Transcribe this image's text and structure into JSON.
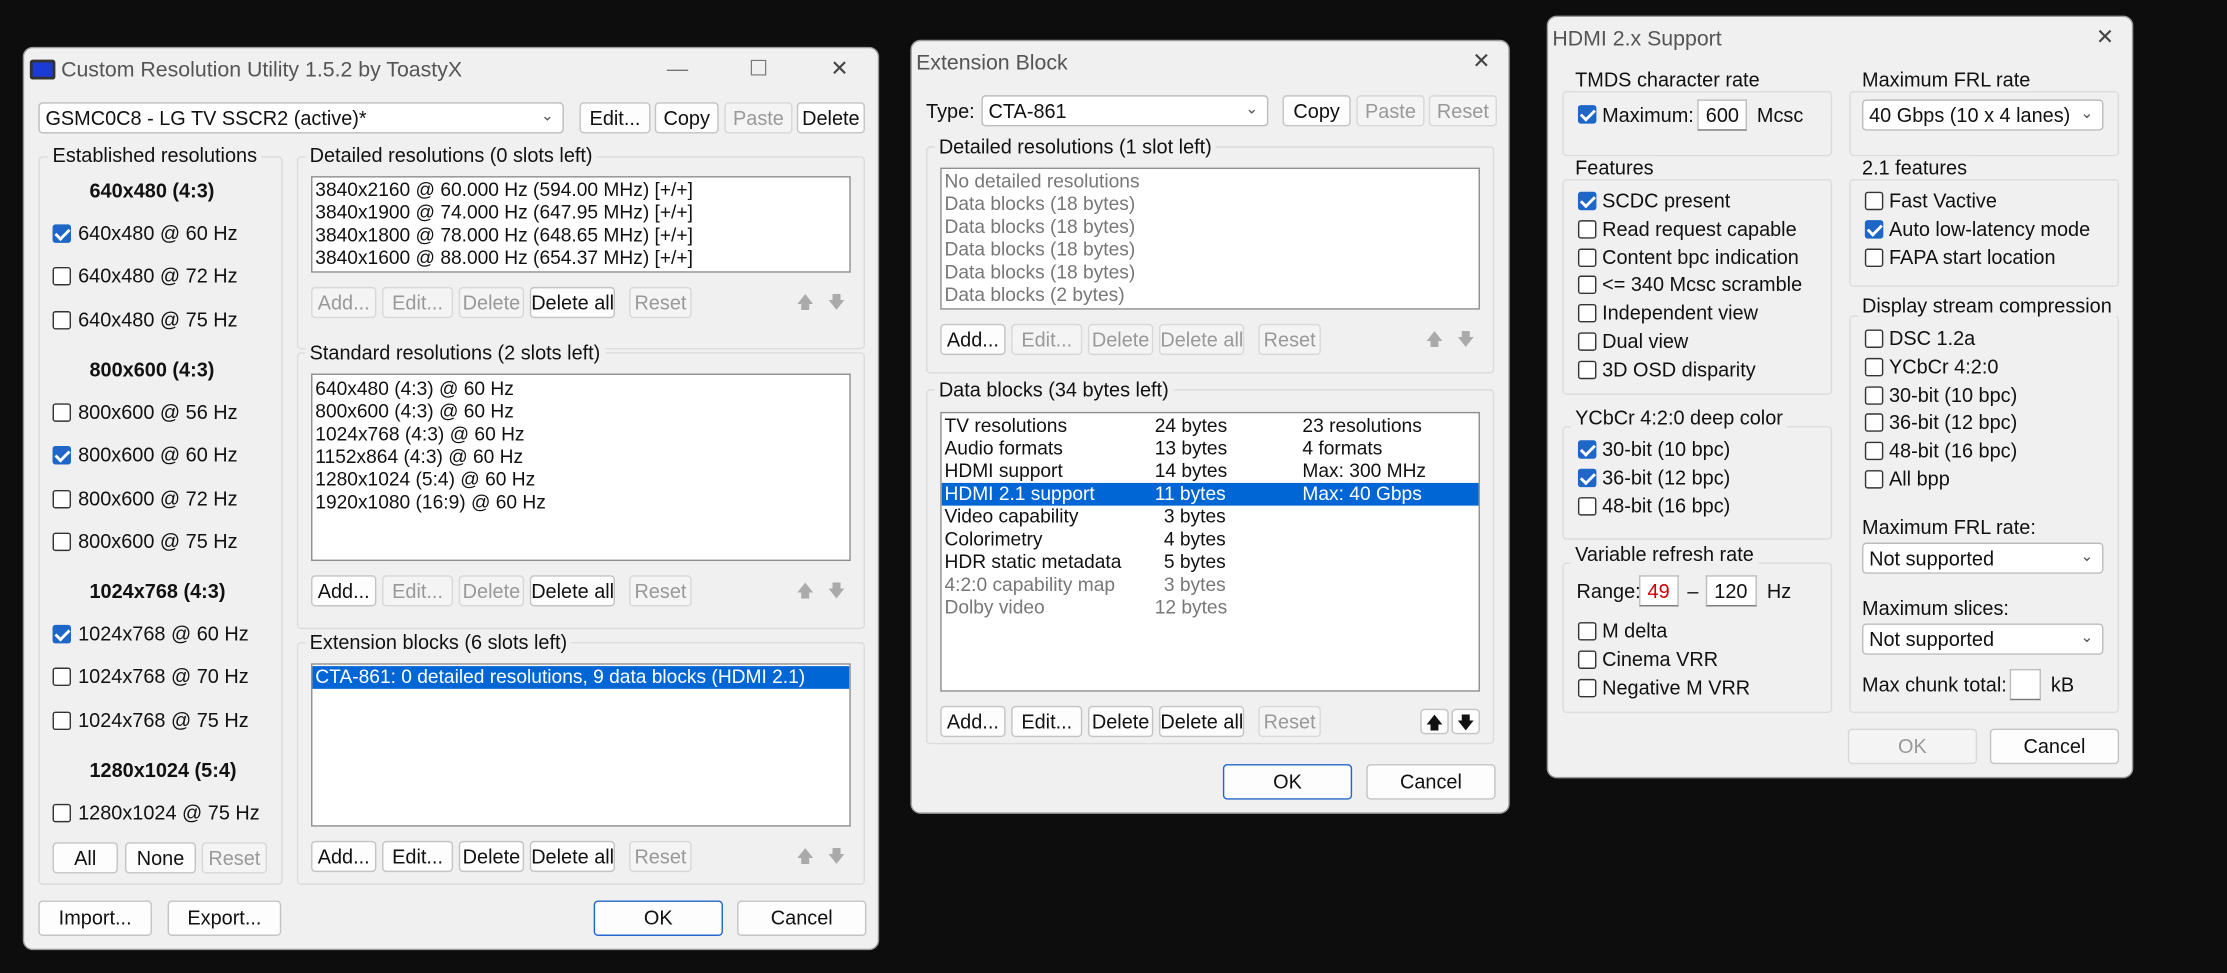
{
  "cru": {
    "title": "Custom Resolution Utility 1.5.2 by ToastyX",
    "display": "GSMC0C8 - LG TV SSCR2 (active)*",
    "top_buttons": [
      "Edit...",
      "Copy",
      "Paste",
      "Delete"
    ],
    "established": {
      "label": "Established resolutions",
      "groups": [
        {
          "heading": "640x480 (4:3)",
          "items": [
            {
              "label": "640x480 @ 60 Hz",
              "checked": true
            },
            {
              "label": "640x480 @ 72 Hz",
              "checked": false
            },
            {
              "label": "640x480 @ 75 Hz",
              "checked": false
            }
          ]
        },
        {
          "heading": "800x600 (4:3)",
          "items": [
            {
              "label": "800x600 @ 56 Hz",
              "checked": false
            },
            {
              "label": "800x600 @ 60 Hz",
              "checked": true
            },
            {
              "label": "800x600 @ 72 Hz",
              "checked": false
            },
            {
              "label": "800x600 @ 75 Hz",
              "checked": false
            }
          ]
        },
        {
          "heading": "1024x768 (4:3)",
          "items": [
            {
              "label": "1024x768 @ 60 Hz",
              "checked": true
            },
            {
              "label": "1024x768 @ 70 Hz",
              "checked": false
            },
            {
              "label": "1024x768 @ 75 Hz",
              "checked": false
            }
          ]
        },
        {
          "heading": "1280x1024 (5:4)",
          "items": [
            {
              "label": "1280x1024 @ 75 Hz",
              "checked": false
            }
          ]
        }
      ],
      "buttons": [
        "All",
        "None",
        "Reset"
      ]
    },
    "detailed": {
      "label": "Detailed resolutions (0 slots left)",
      "rows": [
        "3840x2160 @ 60.000 Hz (594.00 MHz) [+/+]",
        "3840x1900 @ 74.000 Hz (647.95 MHz) [+/+]",
        "3840x1800 @ 78.000 Hz (648.65 MHz) [+/+]",
        "3840x1600 @ 88.000 Hz (654.37 MHz) [+/+]"
      ],
      "buttons": [
        "Add...",
        "Edit...",
        "Delete",
        "Delete all",
        "Reset"
      ]
    },
    "standard": {
      "label": "Standard resolutions (2 slots left)",
      "rows": [
        "640x480 (4:3) @ 60 Hz",
        "800x600 (4:3) @ 60 Hz",
        "1024x768 (4:3) @ 60 Hz",
        "1152x864 (4:3) @ 60 Hz",
        "1280x1024 (5:4) @ 60 Hz",
        "1920x1080 (16:9) @ 60 Hz"
      ],
      "buttons": [
        "Add...",
        "Edit...",
        "Delete",
        "Delete all",
        "Reset"
      ]
    },
    "extension": {
      "label": "Extension blocks (6 slots left)",
      "rows": [
        "CTA-861: 0 detailed resolutions, 9 data blocks (HDMI 2.1)"
      ],
      "buttons": [
        "Add...",
        "Edit...",
        "Delete",
        "Delete all",
        "Reset"
      ]
    },
    "bottom": {
      "import": "Import...",
      "export": "Export...",
      "ok": "OK",
      "cancel": "Cancel"
    }
  },
  "ext": {
    "title": "Extension Block",
    "type_label": "Type:",
    "type_value": "CTA-861",
    "top_buttons": [
      "Copy",
      "Paste",
      "Reset"
    ],
    "detailed": {
      "label": "Detailed resolutions (1 slot left)",
      "rows": [
        "No detailed resolutions",
        "Data blocks (18 bytes)",
        "Data blocks (18 bytes)",
        "Data blocks (18 bytes)",
        "Data blocks (18 bytes)",
        "Data blocks (2 bytes)"
      ],
      "buttons": [
        "Add...",
        "Edit...",
        "Delete",
        "Delete all",
        "Reset"
      ]
    },
    "datablocks": {
      "label": "Data blocks (34 bytes left)",
      "rows": [
        {
          "name": "TV resolutions",
          "size": "24 bytes",
          "info": "23 resolutions"
        },
        {
          "name": "Audio formats",
          "size": "13 bytes",
          "info": "4 formats"
        },
        {
          "name": "HDMI support",
          "size": "14 bytes",
          "info": "Max: 300 MHz"
        },
        {
          "name": "HDMI 2.1 support",
          "size": "11 bytes",
          "info": "Max: 40 Gbps"
        },
        {
          "name": "Video capability",
          "size": "3 bytes",
          "info": ""
        },
        {
          "name": "Colorimetry",
          "size": "4 bytes",
          "info": ""
        },
        {
          "name": "HDR static metadata",
          "size": "5 bytes",
          "info": ""
        },
        {
          "name": "4:2:0 capability map",
          "size": "3 bytes",
          "info": ""
        },
        {
          "name": "Dolby video",
          "size": "12 bytes",
          "info": ""
        }
      ],
      "buttons": [
        "Add...",
        "Edit...",
        "Delete",
        "Delete all",
        "Reset"
      ]
    },
    "ok": "OK",
    "cancel": "Cancel"
  },
  "hdmi": {
    "title": "HDMI 2.x Support",
    "tmds": {
      "label": "TMDS character rate",
      "max_label": "Maximum:",
      "max_value": "600",
      "unit": "Mcsc"
    },
    "features": {
      "label": "Features",
      "items": [
        {
          "label": "SCDC present",
          "checked": true
        },
        {
          "label": "Read request capable",
          "checked": false
        },
        {
          "label": "Content bpc indication",
          "checked": false
        },
        {
          "label": "<= 340 Mcsc scramble",
          "checked": false
        },
        {
          "label": "Independent view",
          "checked": false
        },
        {
          "label": "Dual view",
          "checked": false
        },
        {
          "label": "3D OSD disparity",
          "checked": false
        }
      ]
    },
    "ycbcr": {
      "label": "YCbCr 4:2:0 deep color",
      "items": [
        {
          "label": "30-bit (10 bpc)",
          "checked": true
        },
        {
          "label": "36-bit (12 bpc)",
          "checked": true
        },
        {
          "label": "48-bit (16 bpc)",
          "checked": false
        }
      ]
    },
    "vrr": {
      "label": "Variable refresh rate",
      "range_label": "Range:",
      "min": "49",
      "dash": "–",
      "max": "120",
      "unit": "Hz",
      "items": [
        {
          "label": "M delta",
          "checked": false
        },
        {
          "label": "Cinema VRR",
          "checked": false
        },
        {
          "label": "Negative M VRR",
          "checked": false
        }
      ]
    },
    "frl": {
      "label": "Maximum FRL rate",
      "value": "40 Gbps (10 x 4 lanes)"
    },
    "f21": {
      "label": "2.1 features",
      "items": [
        {
          "label": "Fast Vactive",
          "checked": false
        },
        {
          "label": "Auto low-latency mode",
          "checked": true
        },
        {
          "label": "FAPA start location",
          "checked": false
        }
      ]
    },
    "dsc": {
      "label": "Display stream compression",
      "items": [
        {
          "label": "DSC 1.2a",
          "checked": false
        },
        {
          "label": "YCbCr 4:2:0",
          "checked": false
        },
        {
          "label": "30-bit (10 bpc)",
          "checked": false
        },
        {
          "label": "36-bit (12 bpc)",
          "checked": false
        },
        {
          "label": "48-bit (16 bpc)",
          "checked": false
        },
        {
          "label": "All bpp",
          "checked": false
        }
      ],
      "frl_label": "Maximum FRL rate:",
      "frl_value": "Not supported",
      "slices_label": "Maximum slices:",
      "slices_value": "Not supported",
      "chunk_label": "Max chunk total:",
      "chunk_unit": "kB"
    },
    "ok": "OK",
    "cancel": "Cancel"
  },
  "colors": {
    "accent": "#0066d6",
    "error_text": "#cc0000"
  },
  "icons": [
    "minimize-icon",
    "maximize-icon",
    "close-icon",
    "up-arrow-icon",
    "down-arrow-icon",
    "chevron-down-icon"
  ]
}
